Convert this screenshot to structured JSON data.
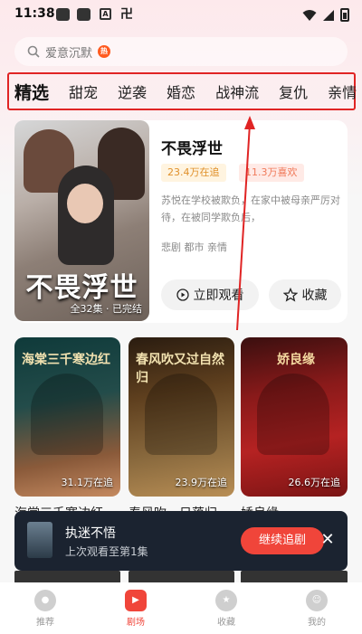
{
  "status_bar": {
    "time": "11:38",
    "icon_label_a": "A",
    "icon_label_b": "卍"
  },
  "search": {
    "placeholder": "爱意沉默",
    "hot_badge": "热"
  },
  "tabs": [
    {
      "label": "精选",
      "active": true
    },
    {
      "label": "甜宠"
    },
    {
      "label": "逆袭"
    },
    {
      "label": "婚恋"
    },
    {
      "label": "战神流"
    },
    {
      "label": "复仇"
    },
    {
      "label": "亲情"
    }
  ],
  "featured": {
    "poster_title": "不畏浮世",
    "poster_eps": "全32集 · 已完结",
    "title": "不畏浮世",
    "tag_following": "23.4万在追",
    "tag_likes": "11.3万喜欢",
    "description": "苏悦在学校被欺负，在家中被母亲严厉对待，在被同学欺负后，",
    "genres": "悲剧 都市 亲情",
    "watch_label": "立即观看",
    "fav_label": "收藏"
  },
  "grid": [
    {
      "poster_title": "海棠三千寒边红",
      "count": "31.1万在追",
      "label": "海棠三千寒边红"
    },
    {
      "poster_title": "春风吹又过自然归",
      "count": "23.9万在追",
      "label": "春风吹，日落归"
    },
    {
      "poster_title": "娇良缘",
      "count": "26.6万在追",
      "label": "娇良缘"
    }
  ],
  "continue": {
    "title": "执迷不悟",
    "subtitle": "上次观看至第1集",
    "button": "继续追剧",
    "close": "✕"
  },
  "nav": [
    {
      "label": "推荐",
      "icon": "recommend-icon",
      "active": false
    },
    {
      "label": "剧场",
      "icon": "theater-icon",
      "active": true
    },
    {
      "label": "收藏",
      "icon": "star-icon",
      "active": false
    },
    {
      "label": "我的",
      "icon": "profile-icon",
      "active": false
    }
  ],
  "colors": {
    "accent": "#f0453a",
    "highlight_box": "#e02424"
  }
}
